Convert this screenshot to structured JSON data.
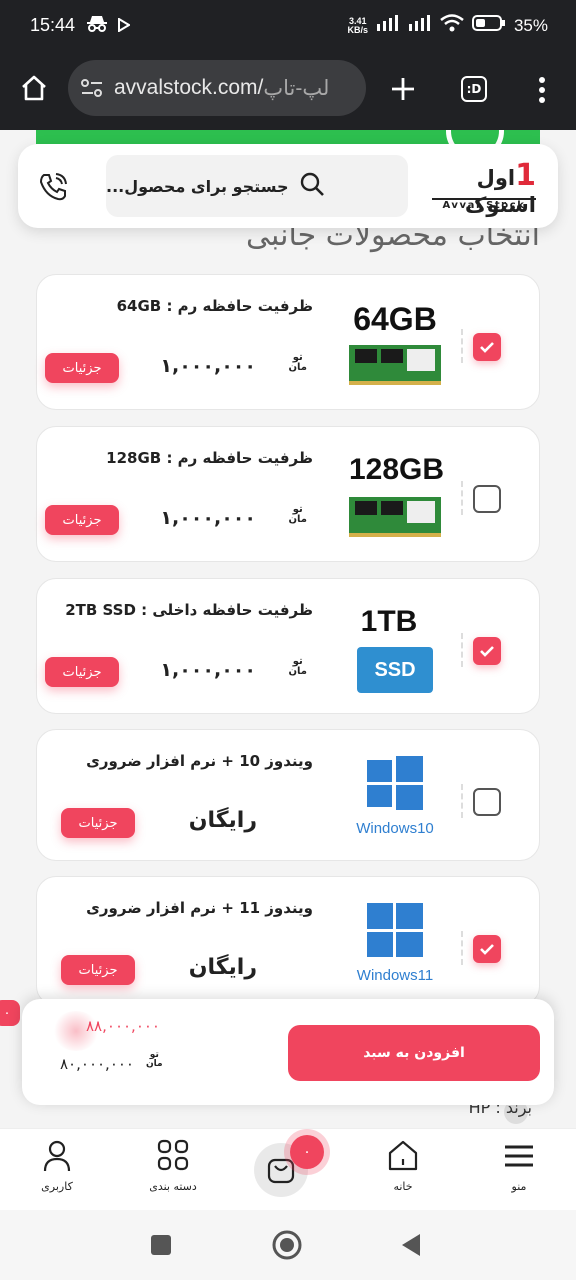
{
  "status_bar": {
    "time": "15:44",
    "net_speed_value": "3.41",
    "net_speed_unit": "KB/s",
    "battery": "35%",
    "icons": [
      "incognito-icon",
      "play-icon",
      "signal-icon",
      "signal-icon",
      "wifi-icon",
      "battery-icon"
    ]
  },
  "browser": {
    "url_domain": "avvalstock.com/",
    "url_path": "لپ-تاپ",
    "icons": [
      "home-icon",
      "site-info-icon",
      "new-tab-icon",
      "tab-switcher-icon",
      "more-menu-icon"
    ],
    "tab_switcher_label": ":D"
  },
  "header": {
    "logo_text": "اول استوک",
    "logo_digit": "1",
    "logo_subtitle": "Avval Stock",
    "search_placeholder": "جستجو برای محصول...",
    "icons": [
      "search-icon",
      "phone-icon"
    ]
  },
  "section_title": "انتخاب محصولات جانبی",
  "products": [
    {
      "title": "ظرفیت حافظه رم : 64GB",
      "price": "۱,۰۰۰,۰۰۰",
      "currency_top": "تو",
      "currency_bottom": "مان",
      "details": "جزئیات",
      "image_caption": "64GB",
      "checked": true
    },
    {
      "title": "ظرفیت حافظه رم : 128GB",
      "price": "۱,۰۰۰,۰۰۰",
      "currency_top": "تو",
      "currency_bottom": "مان",
      "details": "جزئیات",
      "image_caption": "128GB",
      "checked": false
    },
    {
      "title": "ظرفیت حافظه داخلی : 2TB SSD",
      "price": "۱,۰۰۰,۰۰۰",
      "currency_top": "تو",
      "currency_bottom": "مان",
      "details": "جزئیات",
      "image_caption": "1TB",
      "image_badge": "SSD",
      "checked": true
    },
    {
      "title": "ویندوز 10 + نرم افزار ضروری",
      "price": "رایگان",
      "details": "جزئیات",
      "image_caption": "Windows10",
      "checked": false
    },
    {
      "title": "ویندوز 11 + نرم افزار ضروری",
      "price": "رایگان",
      "details": "جزئیات",
      "image_caption": "Windows11",
      "checked": true
    }
  ],
  "cart": {
    "old_price": "۸۸,۰۰۰,۰۰۰",
    "new_price": "۸۰,۰۰۰,۰۰۰",
    "currency_top": "تو",
    "currency_bottom": "مان",
    "add_button": "افزودن به سبد",
    "side_badge": "۰"
  },
  "brand_line": "برند : HP",
  "bottom_nav": {
    "items": [
      {
        "label": "کاربری",
        "icon": "user-icon"
      },
      {
        "label": "دسته بندی",
        "icon": "grid-icon"
      },
      {
        "label": "",
        "icon": "cart-bag-icon"
      },
      {
        "label": "خانه",
        "icon": "home-icon"
      },
      {
        "label": "منو",
        "icon": "hamburger-icon"
      }
    ],
    "cart_badge": "۰"
  },
  "colors": {
    "accent": "#f0455e",
    "dark_bar": "#202124",
    "windows_blue": "#2f7fd0",
    "ram_green": "#2f8a3a"
  }
}
